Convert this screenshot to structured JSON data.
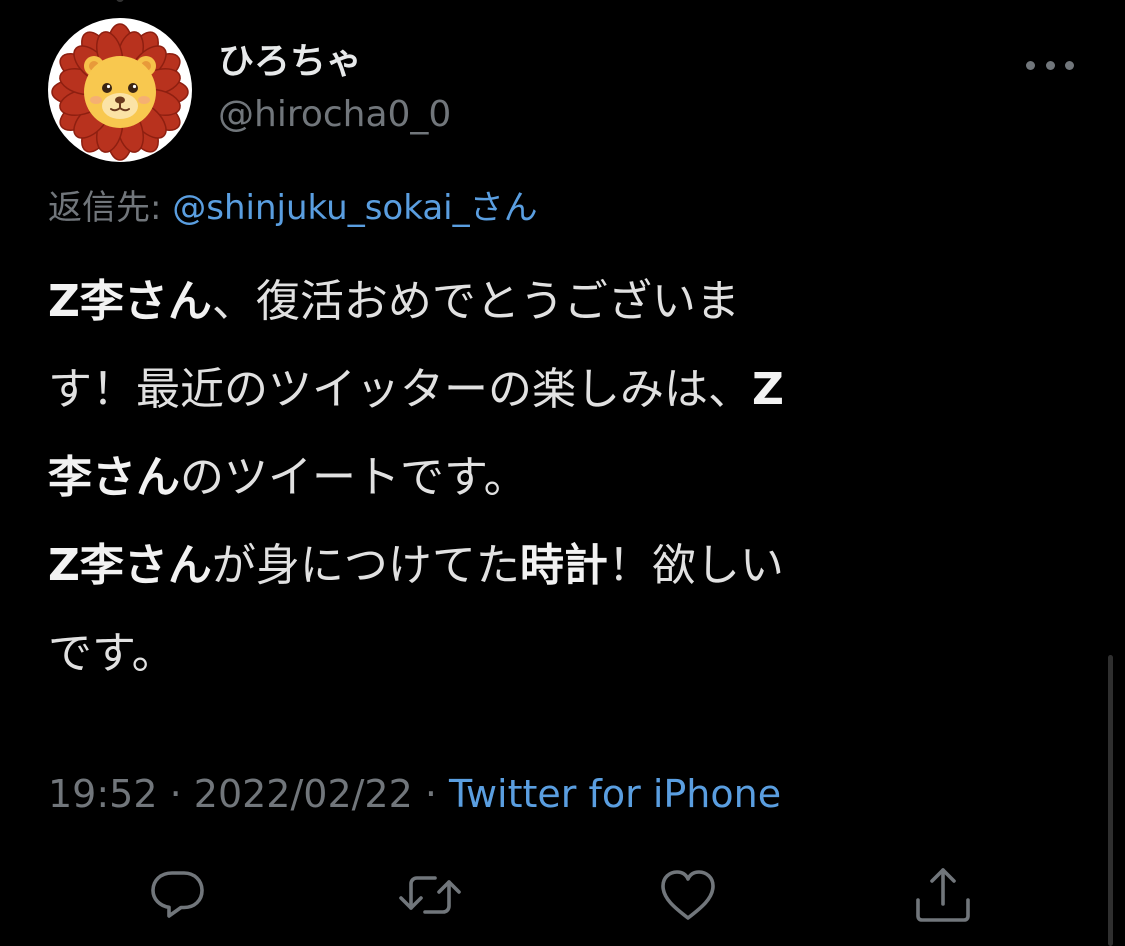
{
  "tweet": {
    "display_name": "ひろちゃ",
    "handle": "@hirocha0_0",
    "reply_prefix": "返信先: ",
    "reply_mention": "@shinjuku_sokai_さん",
    "body_lines": [
      [
        {
          "text": "Z李さん",
          "bold": true
        },
        {
          "text": "、復活おめでとうございま",
          "bold": false
        }
      ],
      [
        {
          "text": "す！最近のツイッターの楽しみは、",
          "bold": false
        },
        {
          "text": "Z",
          "bold": true
        }
      ],
      [
        {
          "text": "李さん",
          "bold": true
        },
        {
          "text": "のツイートです。",
          "bold": false
        }
      ],
      [
        {
          "text": "Z李さん",
          "bold": true
        },
        {
          "text": "が身につけてた",
          "bold": false
        },
        {
          "text": "時計",
          "bold": true
        },
        {
          "text": "！欲しい",
          "bold": false
        }
      ],
      [
        {
          "text": "です。",
          "bold": false
        }
      ]
    ],
    "time": "19:52",
    "separator": " · ",
    "date": "2022/02/22",
    "source": "Twitter for iPhone"
  },
  "icons": {
    "avatar": "lion-avatar-icon",
    "more": "more-horizontal-icon",
    "reply": "reply-bubble-icon",
    "retweet": "retweet-icon",
    "like": "heart-icon",
    "share": "share-upload-icon"
  },
  "colors": {
    "background": "#000000",
    "text": "#e1e1e1",
    "muted": "#71767b",
    "link": "#5a9ee0"
  }
}
